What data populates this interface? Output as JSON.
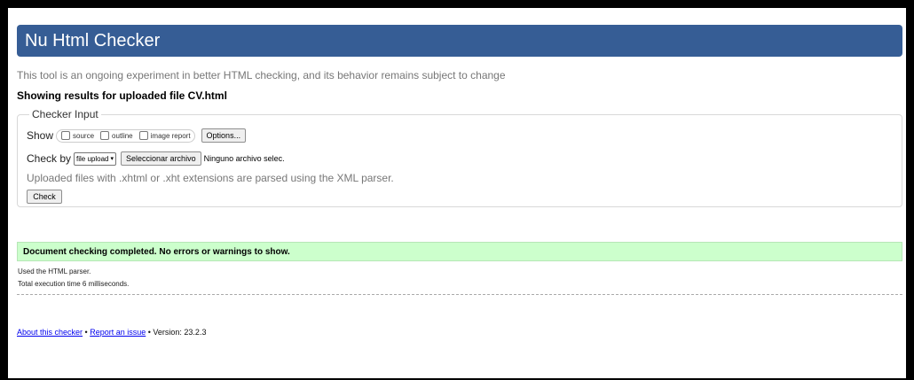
{
  "banner": {
    "title": "Nu Html Checker"
  },
  "intro": "This tool is an ongoing experiment in better HTML checking, and its behavior remains subject to change",
  "results_heading": "Showing results for uploaded file CV.html",
  "checker_input": {
    "legend": "Checker Input",
    "show_label": "Show",
    "show_options": [
      "source",
      "outline",
      "image report"
    ],
    "options_button": "Options...",
    "check_by_label": "Check by",
    "check_by_value": "file upload",
    "file_button": "Seleccionar archivo",
    "file_status": "Ninguno archivo selec.",
    "xml_note": "Uploaded files with .xhtml or .xht extensions are parsed using the XML parser.",
    "check_button": "Check"
  },
  "result": {
    "message": "Document checking completed. No errors or warnings to show.",
    "parser_note": "Used the HTML parser.",
    "execution_time": "Total execution time 6 milliseconds."
  },
  "footer": {
    "about_link": "About this checker",
    "separator_1": " • ",
    "report_link": "Report an issue",
    "version_text": " • Version: 23.2.3"
  }
}
